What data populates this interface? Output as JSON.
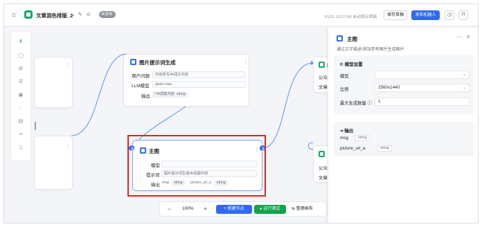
{
  "topbar": {
    "app_title": "文章润色排版_2",
    "draft_badge": "未发布",
    "autosave_status": "01/21 16:27:56 自动保存草稿",
    "save_draft_label": "保存草稿",
    "publish_bot_label": "发布机器人"
  },
  "nodes": {
    "image_prompt": {
      "title": "图片提示词生成",
      "rows": [
        {
          "label": "用户问题",
          "value": "内容改写/AI润文内容"
        },
        {
          "label": "LLM模型",
          "value": "qwen-max"
        }
      ],
      "output_label": "输出",
      "output_var": "* AI润案内容",
      "output_type": "string"
    },
    "main_image": {
      "title": "主图",
      "model_label": "模型",
      "model_value": "",
      "prompt_label": "提示词",
      "prompt_value": "图片提示词生成/AI润案内容",
      "output_label": "输出",
      "outputs": [
        {
          "name": "msg",
          "type": "string"
        },
        {
          "name": "picture_url_a",
          "type": "string"
        }
      ]
    },
    "right_top": {
      "title_fragment": "新",
      "row1": "公众号",
      "row2": "文章美"
    },
    "right_bottom": {
      "row1": "公众",
      "row2": "文章"
    }
  },
  "toolbar": {
    "zoom": "100%",
    "add_node_label": "+ 新建节点",
    "run_test_label": "运行测试",
    "layout_label": "整理画布"
  },
  "panel": {
    "title": "主图",
    "description": "通过文字描述/添加参考图片生成图片",
    "model_settings": {
      "header": "模型设置",
      "model_label": "模型",
      "model_value": "",
      "ratio_label": "比例",
      "ratio_value": "2560x1440",
      "max_count_label": "最大生成数量",
      "max_count_value": "1"
    },
    "output": {
      "header": "输出",
      "items": [
        {
          "name": "msg",
          "type": "string"
        },
        {
          "name": "picture_url_a",
          "type": "string"
        }
      ]
    }
  },
  "colors": {
    "accent": "#2f6bf2",
    "run_green": "#14a34a",
    "highlight_red": "#e02020",
    "logo_green": "#1aa86b"
  }
}
